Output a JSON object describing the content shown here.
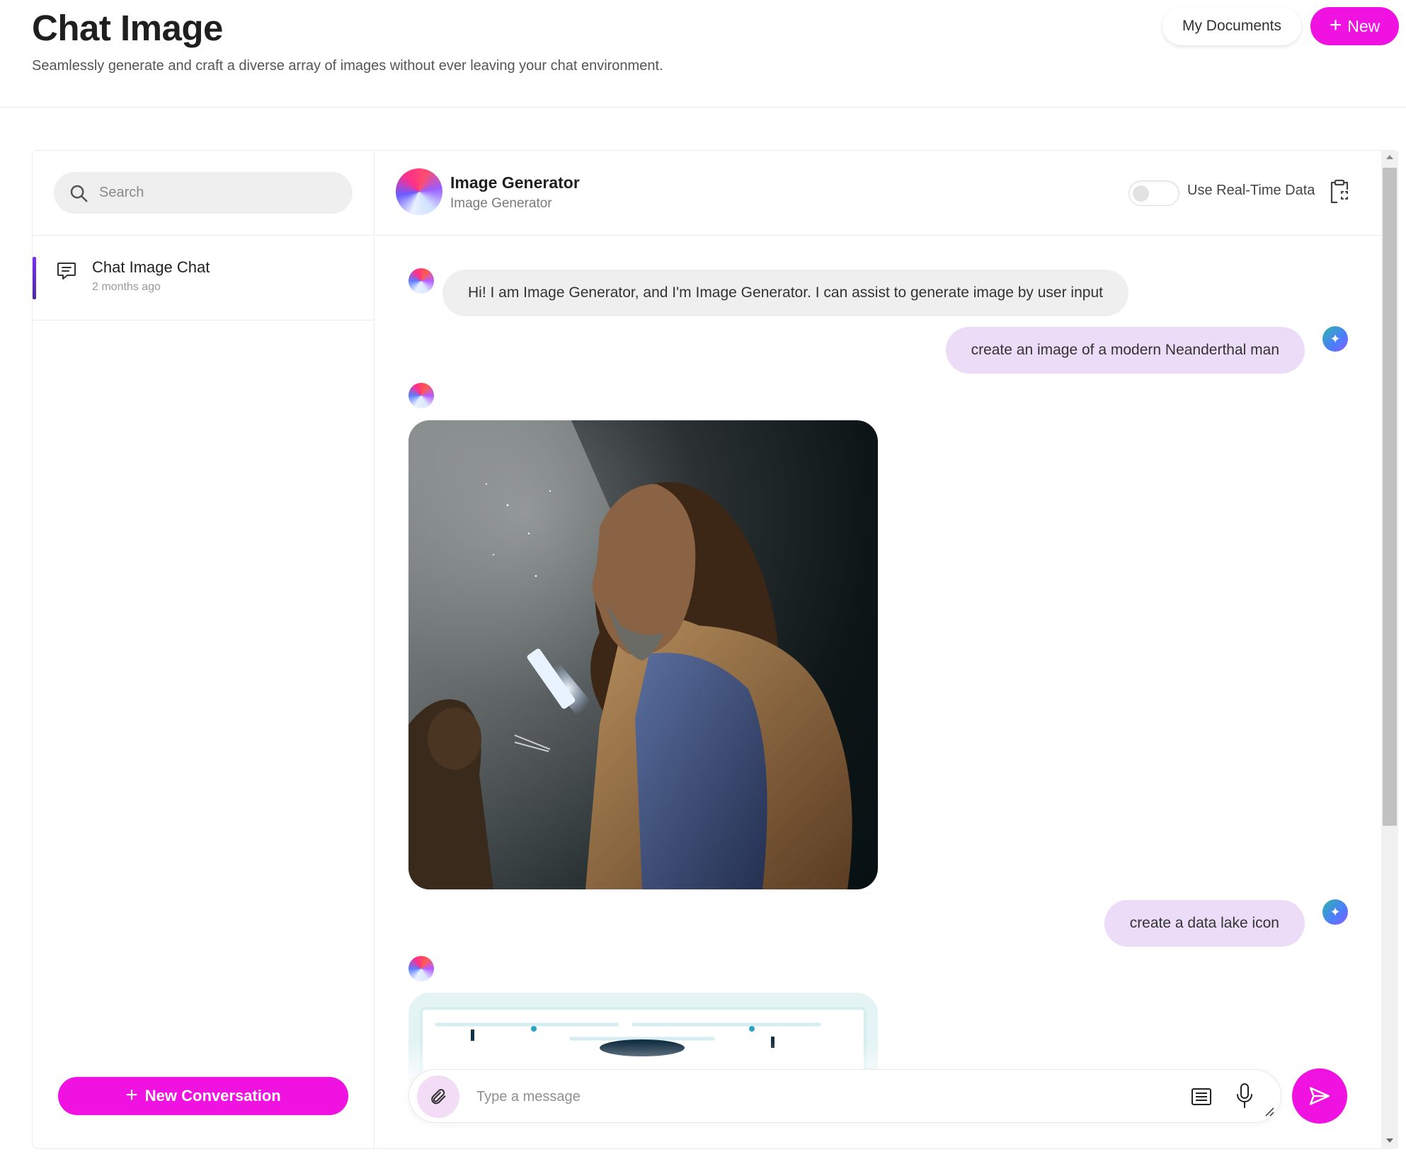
{
  "app": {
    "title": "Chat Image",
    "subtitle": "Seamlessly generate and craft a diverse array of images without ever leaving your chat environment.",
    "my_documents_label": "My Documents",
    "new_label": "New",
    "accent_color": "#f012e0"
  },
  "sidebar": {
    "search_placeholder": "Search",
    "conversations": [
      {
        "title": "Chat Image Chat",
        "time": "2 months ago",
        "icon": "chat-bubble-icon"
      }
    ],
    "new_conversation_label": "New Conversation"
  },
  "chat": {
    "header": {
      "title": "Image Generator",
      "subtitle": "Image Generator",
      "realtime_label": "Use Real-Time Data",
      "realtime_enabled": false
    },
    "messages": [
      {
        "role": "bot",
        "text": "Hi! I am Image Generator, and I'm Image Generator. I can assist to generate image by user input"
      },
      {
        "role": "user",
        "text": "create an image of a modern Neanderthal man"
      },
      {
        "role": "bot",
        "image": "neanderthal-with-phone"
      },
      {
        "role": "user",
        "text": "create a data lake icon"
      },
      {
        "role": "bot",
        "image": "data-lake-icon"
      }
    ],
    "composer": {
      "placeholder": "Type a message"
    }
  }
}
